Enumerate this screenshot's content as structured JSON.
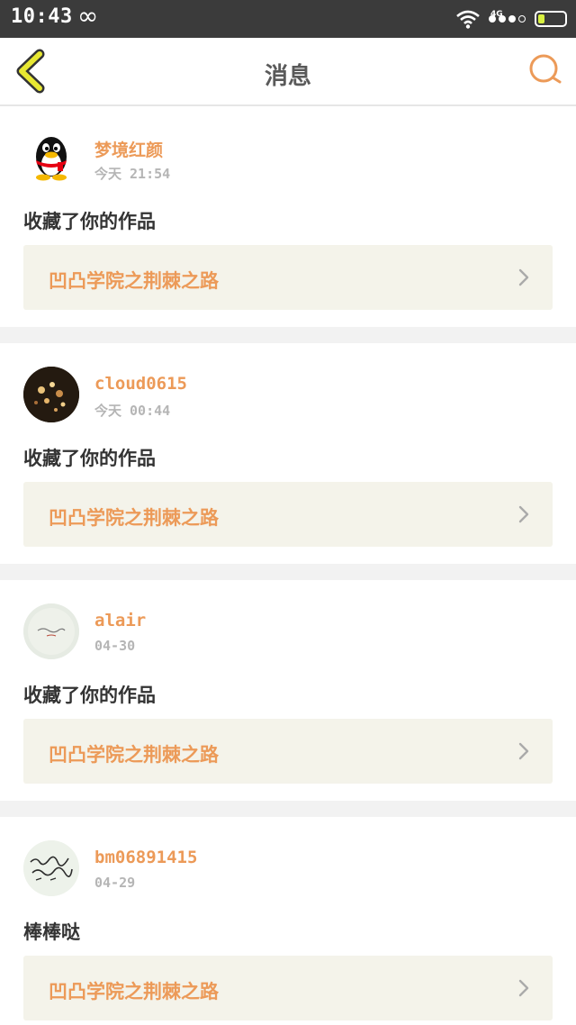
{
  "status_bar": {
    "time": "10:43",
    "infinity_symbol": "∞",
    "network": "4G",
    "icons": [
      "wifi-icon",
      "signal-icon",
      "battery-icon"
    ]
  },
  "nav": {
    "title": "消息",
    "back_icon": "back-chevron-icon",
    "search_icon": "search-icon",
    "accent_color": "#ec9a58"
  },
  "messages": [
    {
      "user": "梦境红颜",
      "time": "今天 21:54",
      "action": "收藏了你的作品",
      "work": "凹凸学院之荆棘之路",
      "avatar": "qq-penguin-avatar"
    },
    {
      "user": "cloud0615",
      "time": "今天 00:44",
      "action": "收藏了你的作品",
      "work": "凹凸学院之荆棘之路",
      "avatar": "night-lights-avatar"
    },
    {
      "user": "alair",
      "time": "04-30",
      "action": "收藏了你的作品",
      "work": "凹凸学院之荆棘之路",
      "avatar": "calligraphy-plate-avatar"
    },
    {
      "user": "bm06891415",
      "time": "04-29",
      "action": "棒棒哒",
      "work": "凹凸学院之荆棘之路",
      "avatar": "handwriting-avatar"
    }
  ]
}
